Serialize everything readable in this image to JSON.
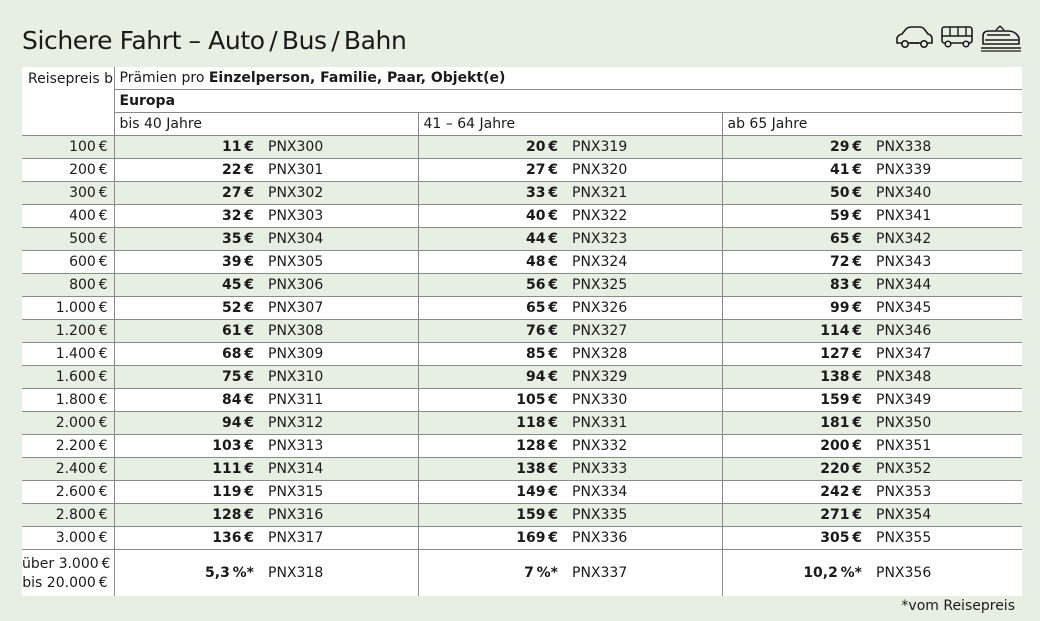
{
  "title": "Sichere Fahrt – Auto / Bus / Bahn",
  "icons": [
    "car-icon",
    "bus-icon",
    "train-icon"
  ],
  "header": {
    "price_label": "Reisepreis bis",
    "praemien_prefix": "Prämien pro ",
    "praemien_bold": "Einzelperson, Familie, Paar, Objekt(e)",
    "region": "Europa",
    "ages": [
      "bis 40 Jahre",
      "41 – 64 Jahre",
      "ab 65 Jahre"
    ]
  },
  "rows": [
    {
      "price": "100 €",
      "c1": "11 €",
      "k1": "PNX300",
      "c2": "20 €",
      "k2": "PNX319",
      "c3": "29 €",
      "k3": "PNX338"
    },
    {
      "price": "200 €",
      "c1": "22 €",
      "k1": "PNX301",
      "c2": "27 €",
      "k2": "PNX320",
      "c3": "41 €",
      "k3": "PNX339"
    },
    {
      "price": "300 €",
      "c1": "27 €",
      "k1": "PNX302",
      "c2": "33 €",
      "k2": "PNX321",
      "c3": "50 €",
      "k3": "PNX340"
    },
    {
      "price": "400 €",
      "c1": "32 €",
      "k1": "PNX303",
      "c2": "40 €",
      "k2": "PNX322",
      "c3": "59 €",
      "k3": "PNX341"
    },
    {
      "price": "500 €",
      "c1": "35 €",
      "k1": "PNX304",
      "c2": "44 €",
      "k2": "PNX323",
      "c3": "65 €",
      "k3": "PNX342"
    },
    {
      "price": "600 €",
      "c1": "39 €",
      "k1": "PNX305",
      "c2": "48 €",
      "k2": "PNX324",
      "c3": "72 €",
      "k3": "PNX343"
    },
    {
      "price": "800 €",
      "c1": "45 €",
      "k1": "PNX306",
      "c2": "56 €",
      "k2": "PNX325",
      "c3": "83 €",
      "k3": "PNX344"
    },
    {
      "price": "1.000 €",
      "c1": "52 €",
      "k1": "PNX307",
      "c2": "65 €",
      "k2": "PNX326",
      "c3": "99 €",
      "k3": "PNX345"
    },
    {
      "price": "1.200 €",
      "c1": "61 €",
      "k1": "PNX308",
      "c2": "76 €",
      "k2": "PNX327",
      "c3": "114 €",
      "k3": "PNX346"
    },
    {
      "price": "1.400 €",
      "c1": "68 €",
      "k1": "PNX309",
      "c2": "85 €",
      "k2": "PNX328",
      "c3": "127 €",
      "k3": "PNX347"
    },
    {
      "price": "1.600 €",
      "c1": "75 €",
      "k1": "PNX310",
      "c2": "94 €",
      "k2": "PNX329",
      "c3": "138 €",
      "k3": "PNX348"
    },
    {
      "price": "1.800 €",
      "c1": "84 €",
      "k1": "PNX311",
      "c2": "105 €",
      "k2": "PNX330",
      "c3": "159 €",
      "k3": "PNX349"
    },
    {
      "price": "2.000 €",
      "c1": "94 €",
      "k1": "PNX312",
      "c2": "118 €",
      "k2": "PNX331",
      "c3": "181 €",
      "k3": "PNX350"
    },
    {
      "price": "2.200 €",
      "c1": "103 €",
      "k1": "PNX313",
      "c2": "128 €",
      "k2": "PNX332",
      "c3": "200 €",
      "k3": "PNX351"
    },
    {
      "price": "2.400 €",
      "c1": "111 €",
      "k1": "PNX314",
      "c2": "138 €",
      "k2": "PNX333",
      "c3": "220 €",
      "k3": "PNX352"
    },
    {
      "price": "2.600 €",
      "c1": "119 €",
      "k1": "PNX315",
      "c2": "149 €",
      "k2": "PNX334",
      "c3": "242 €",
      "k3": "PNX353"
    },
    {
      "price": "2.800 €",
      "c1": "128 €",
      "k1": "PNX316",
      "c2": "159 €",
      "k2": "PNX335",
      "c3": "271 €",
      "k3": "PNX354"
    },
    {
      "price": "3.000 €",
      "c1": "136 €",
      "k1": "PNX317",
      "c2": "169 €",
      "k2": "PNX336",
      "c3": "305 €",
      "k3": "PNX355"
    }
  ],
  "last_row": {
    "price_line1": "über 3.000 €",
    "price_line2": "bis 20.000 €",
    "c1": "5,3 %*",
    "k1": "PNX318",
    "c2": "7 %*",
    "k2": "PNX337",
    "c3": "10,2 %*",
    "k3": "PNX356"
  },
  "footnote": "*vom Reisepreis"
}
